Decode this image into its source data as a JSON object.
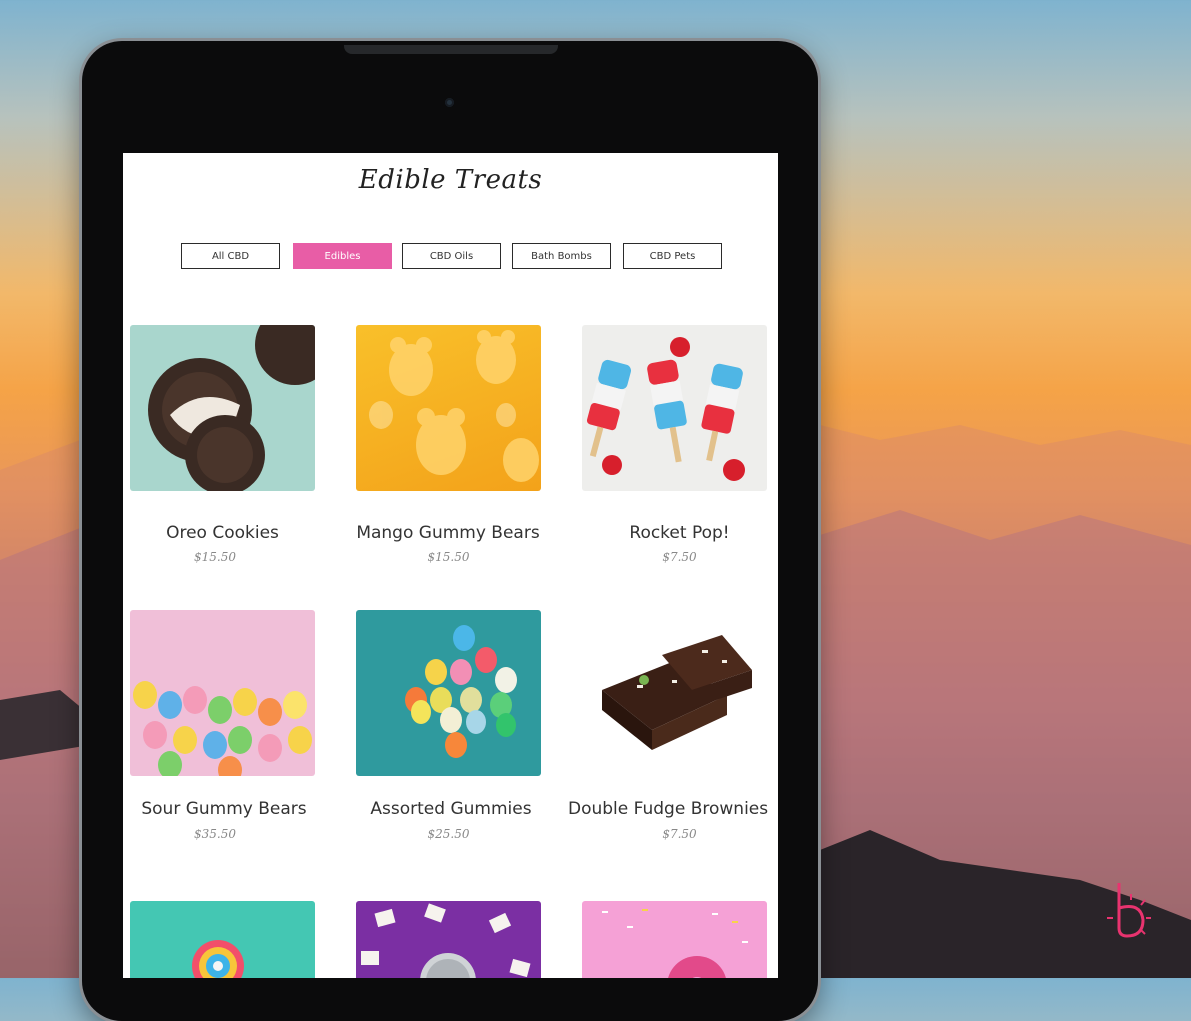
{
  "page": {
    "title": "Edible Treats"
  },
  "filters": [
    {
      "label": "All CBD",
      "active": false
    },
    {
      "label": "Edibles",
      "active": true
    },
    {
      "label": "CBD Oils",
      "active": false
    },
    {
      "label": "Bath Bombs",
      "active": false
    },
    {
      "label": "CBD Pets",
      "active": false
    }
  ],
  "products": [
    {
      "name": "Oreo Cookies",
      "price": "$15.50",
      "image": "oreo-cookies-image"
    },
    {
      "name": "Mango Gummy Bears",
      "price": "$15.50",
      "image": "mango-gummy-bears-image"
    },
    {
      "name": "Rocket Pop!",
      "price": "$7.50",
      "image": "rocket-pop-image"
    },
    {
      "name": "Sour Gummy Bears",
      "price": "$35.50",
      "image": "sour-gummy-bears-image"
    },
    {
      "name": "Assorted Gummies",
      "price": "$25.50",
      "image": "assorted-gummies-image"
    },
    {
      "name": "Double Fudge Brownies",
      "price": "$7.50",
      "image": "brownies-image"
    },
    {
      "name": "",
      "price": "",
      "image": "lollipop-image"
    },
    {
      "name": "",
      "price": "",
      "image": "marshmallows-can-image"
    },
    {
      "name": "",
      "price": "",
      "image": "sprinkle-donut-image"
    }
  ],
  "colors": {
    "accent": "#e85da6",
    "brand_logo": "#e8336f"
  },
  "icons": {
    "brand": "brand-b-sun-logo-icon",
    "camera": "front-camera-icon"
  }
}
